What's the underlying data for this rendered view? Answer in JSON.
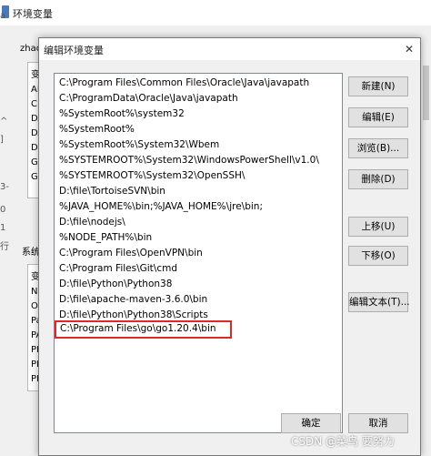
{
  "background_window": {
    "title": "环境变量",
    "user_vars_label": "zhao",
    "user_col_head": "变",
    "user_rows": [
      "AI",
      "CL",
      "DA",
      "DA",
      "DI",
      "GA",
      "GC"
    ],
    "sys_vars_label": "系统",
    "sys_col_head": "变",
    "sys_rows": [
      "NU",
      "O!",
      "Pa",
      "PA",
      "PF",
      "PF",
      "PF"
    ],
    "edge_chars": [
      "a",
      "^",
      "]",
      "3-",
      "0",
      "1",
      "行"
    ]
  },
  "dialog": {
    "title": "编辑环境变量",
    "path_entries": [
      "C:\\Program Files\\Common Files\\Oracle\\Java\\javapath",
      "C:\\ProgramData\\Oracle\\Java\\javapath",
      "%SystemRoot%\\system32",
      "%SystemRoot%",
      "%SystemRoot%\\System32\\Wbem",
      "%SYSTEMROOT%\\System32\\WindowsPowerShell\\v1.0\\",
      "%SYSTEMROOT%\\System32\\OpenSSH\\",
      "D:\\file\\TortoiseSVN\\bin",
      "%JAVA_HOME%\\bin;%JAVA_HOME%\\jre\\bin;",
      "D:\\file\\nodejs\\",
      "%NODE_PATH%\\bin",
      "C:\\Program Files\\OpenVPN\\bin",
      "C:\\Program Files\\Git\\cmd",
      "D:\\file\\Python\\Python38",
      "D:\\file\\apache-maven-3.6.0\\bin",
      "D:\\file\\Python\\Python38\\Scripts",
      "C:\\Program Files\\go\\go1.20.4\\bin"
    ],
    "selected_index": 16,
    "buttons": {
      "new": "新建(N)",
      "edit": "编辑(E)",
      "browse": "浏览(B)...",
      "delete": "删除(D)",
      "move_up": "上移(U)",
      "move_down": "下移(O)",
      "edit_text": "编辑文本(T)...",
      "ok": "确定",
      "cancel": "取消"
    }
  },
  "watermark": "CSDN @菜鸟 要努力",
  "colors": {
    "selection_outline": "#e02828",
    "dialog_bg": "#f0f0f0",
    "button_bg": "#e1e1e1"
  }
}
